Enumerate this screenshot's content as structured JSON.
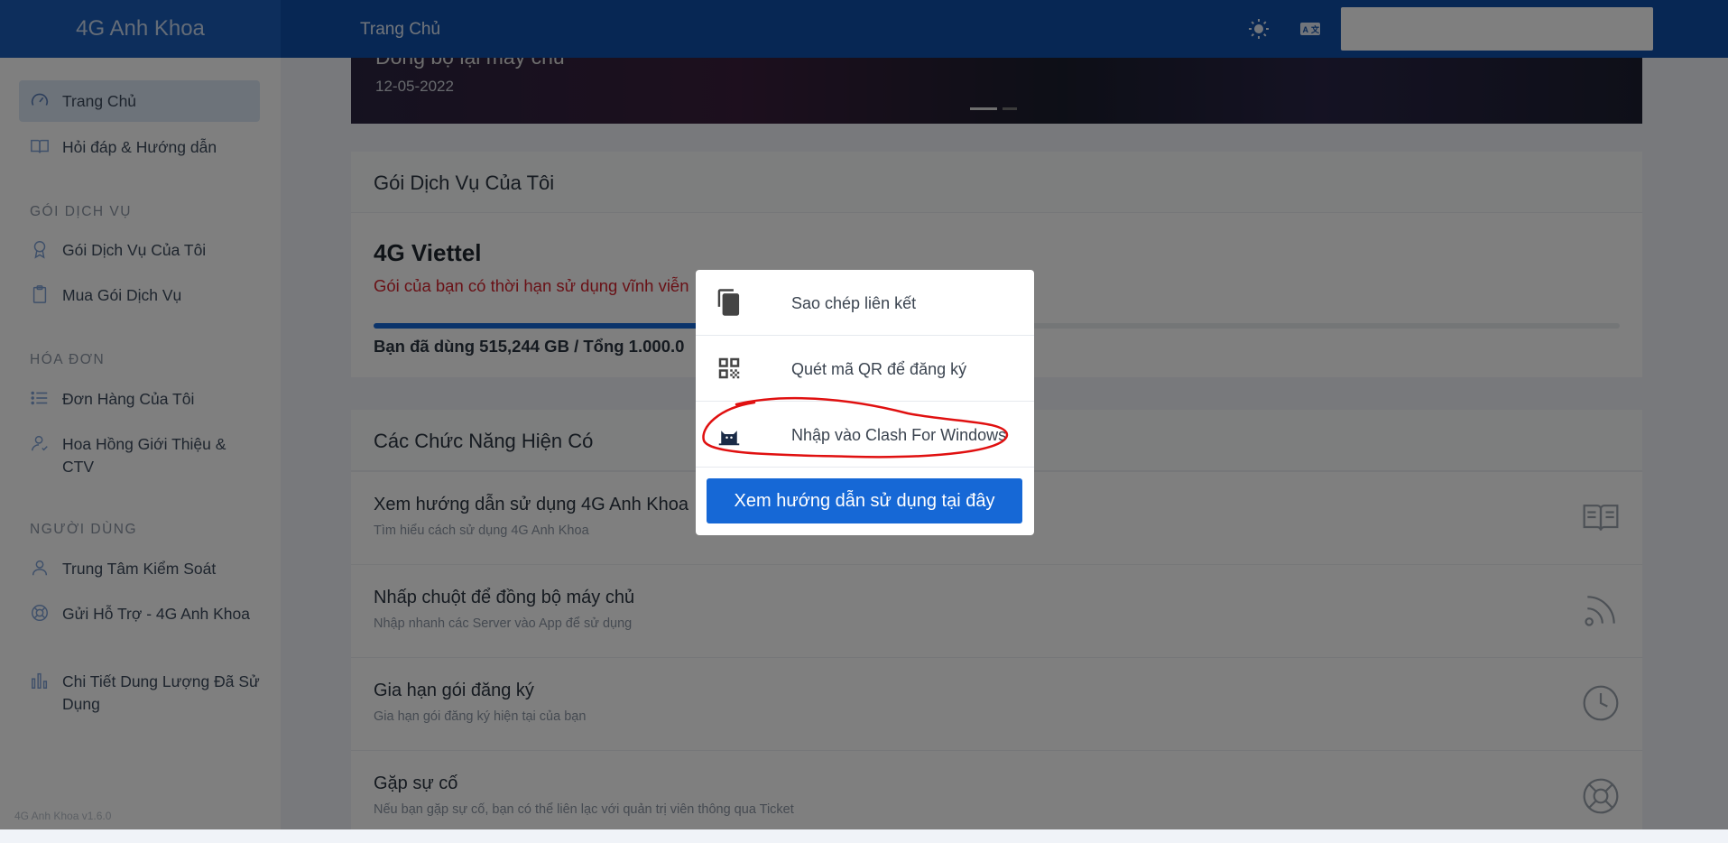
{
  "header": {
    "brand": "4G Anh Khoa",
    "breadcrumb": "Trang Chủ",
    "icons": [
      "sun-icon",
      "translate-icon"
    ],
    "search_value": ""
  },
  "sidebar": {
    "sections": {
      "service": "GÓI DỊCH VỤ",
      "invoice": "HÓA ĐƠN",
      "user": "NGƯỜI DÙNG"
    },
    "items": [
      {
        "label": "Trang Chủ",
        "icon": "dashboard-icon",
        "active": true
      },
      {
        "label": "Hỏi đáp & Hướng dẫn",
        "icon": "book-icon"
      },
      {
        "label": "Gói Dịch Vụ Của Tôi",
        "icon": "award-icon"
      },
      {
        "label": "Mua Gói Dịch Vụ",
        "icon": "clipboard-icon"
      },
      {
        "label": "Đơn Hàng Của Tôi",
        "icon": "list-icon"
      },
      {
        "label": "Hoa Hồng Giới Thiệu & CTV",
        "icon": "user-check-icon"
      },
      {
        "label": "Trung Tâm Kiểm Soát",
        "icon": "user-icon"
      },
      {
        "label": "Gửi Hỗ Trợ - 4G Anh Khoa",
        "icon": "lifebuoy-icon"
      },
      {
        "label": "Chi Tiết Dung Lượng Đã Sử Dụng",
        "icon": "bar-chart-icon"
      }
    ],
    "version": "4G Anh Khoa v1.6.0"
  },
  "banner": {
    "title": "Đồng bộ lại máy chủ",
    "date": "12-05-2022"
  },
  "subscription": {
    "card_title": "Gói Dịch Vụ Của Tôi",
    "plan_name": "4G Viettel",
    "plan_note": "Gói của bạn có thời hạn sử dụng vĩnh viễn",
    "usage": "Bạn đã dùng 515,244 GB / Tổng 1.000.0",
    "usage_fraction": 0.515
  },
  "features": {
    "card_title": "Các Chức Năng Hiện Có",
    "items": [
      {
        "title": "Xem hướng dẫn sử dụng 4G Anh Khoa",
        "subtitle": "Tìm hiểu cách sử dụng 4G Anh Khoa",
        "icon": "book-icon"
      },
      {
        "title": "Nhấp chuột để đồng bộ máy chủ",
        "subtitle": "Nhập nhanh các Server vào App để sử dụng",
        "icon": "rss-icon"
      },
      {
        "title": "Gia hạn gói đăng ký",
        "subtitle": "Gia hạn gói đăng ký hiện tại của bạn",
        "icon": "clock-icon"
      },
      {
        "title": "Gặp sự cố",
        "subtitle": "Nếu bạn gặp sự cố, bạn có thể liên lạc với quản trị viên thông qua Ticket",
        "icon": "lifebuoy-icon"
      }
    ]
  },
  "modal": {
    "options": [
      {
        "label": "Sao chép liên kết",
        "icon": "copy-icon"
      },
      {
        "label": "Quét mã QR để đăng ký",
        "icon": "qrcode-icon"
      },
      {
        "label": "Nhập vào Clash For Windows",
        "icon": "clash-cat-icon"
      }
    ],
    "button_label": "Xem hướng dẫn sử dụng tại đây",
    "annotation_color": "#e01010"
  },
  "colors": {
    "header": "#0f4fa8",
    "primary_button": "#1668d6",
    "alert_text": "#d2222d"
  }
}
